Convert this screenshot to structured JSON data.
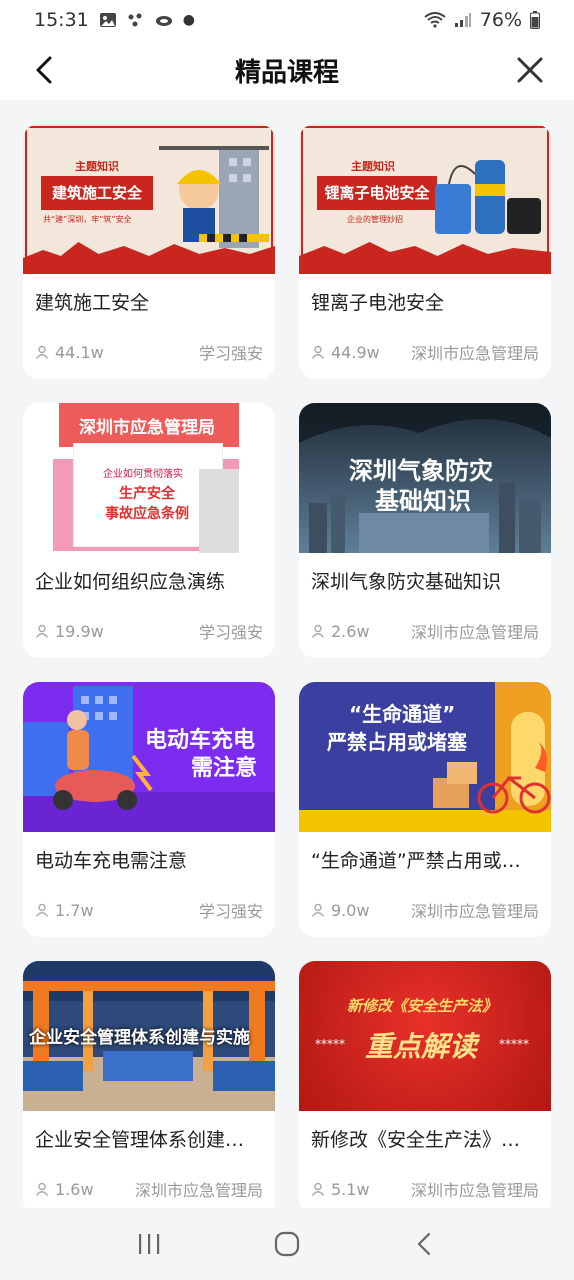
{
  "status_bar": {
    "time": "15:31",
    "battery": "76%"
  },
  "header": {
    "title": "精品课程"
  },
  "courses": [
    {
      "title": "建筑施工安全",
      "views": "44.1w",
      "source": "学习强安",
      "thumb_tag": "主题知识",
      "thumb_main": "建筑施工安全",
      "thumb_sub": "共“建”深圳，牢“筑”安全"
    },
    {
      "title": "锂离子电池安全",
      "views": "44.9w",
      "source": "深圳市应急管理局",
      "thumb_tag": "主题知识",
      "thumb_main": "锂离子电池安全",
      "thumb_sub": "企业的管理妙招"
    },
    {
      "title": "企业如何组织应急演练",
      "views": "19.9w",
      "source": "学习强安",
      "thumb_top": "深圳市应急管理局",
      "thumb_small": "企业如何贯彻落实",
      "thumb_main": "生产安全",
      "thumb_sub": "事故应急条例"
    },
    {
      "title": "深圳气象防灾基础知识",
      "views": "2.6w",
      "source": "深圳市应急管理局",
      "thumb_main": "深圳气象防灾",
      "thumb_sub": "基础知识"
    },
    {
      "title": "电动车充电需注意",
      "views": "1.7w",
      "source": "学习强安",
      "thumb_main": "电动车充电",
      "thumb_sub": "需注意"
    },
    {
      "title": "“生命通道”严禁占用或堵塞",
      "views": "9.0w",
      "source": "深圳市应急管理局",
      "thumb_main": "“生命通道”",
      "thumb_sub": "严禁占用或堵塞"
    },
    {
      "title": "企业安全管理体系创建与实施",
      "views": "1.6w",
      "source": "深圳市应急管理局",
      "thumb_main": "企业安全管理体系创建与实施"
    },
    {
      "title": "新修改《安全生产法》重点解读",
      "views": "5.1w",
      "source": "深圳市应急管理局",
      "thumb_top": "新修改《安全生产法》",
      "thumb_main": "重点解读",
      "thumb_stars": "*****"
    }
  ],
  "colors": {
    "accent_red": "#c8261f",
    "purple": "#7b2cf0",
    "text_gray": "#999999"
  },
  "icons": {
    "back": "back-arrow-icon",
    "close": "close-icon",
    "views": "person-icon"
  }
}
